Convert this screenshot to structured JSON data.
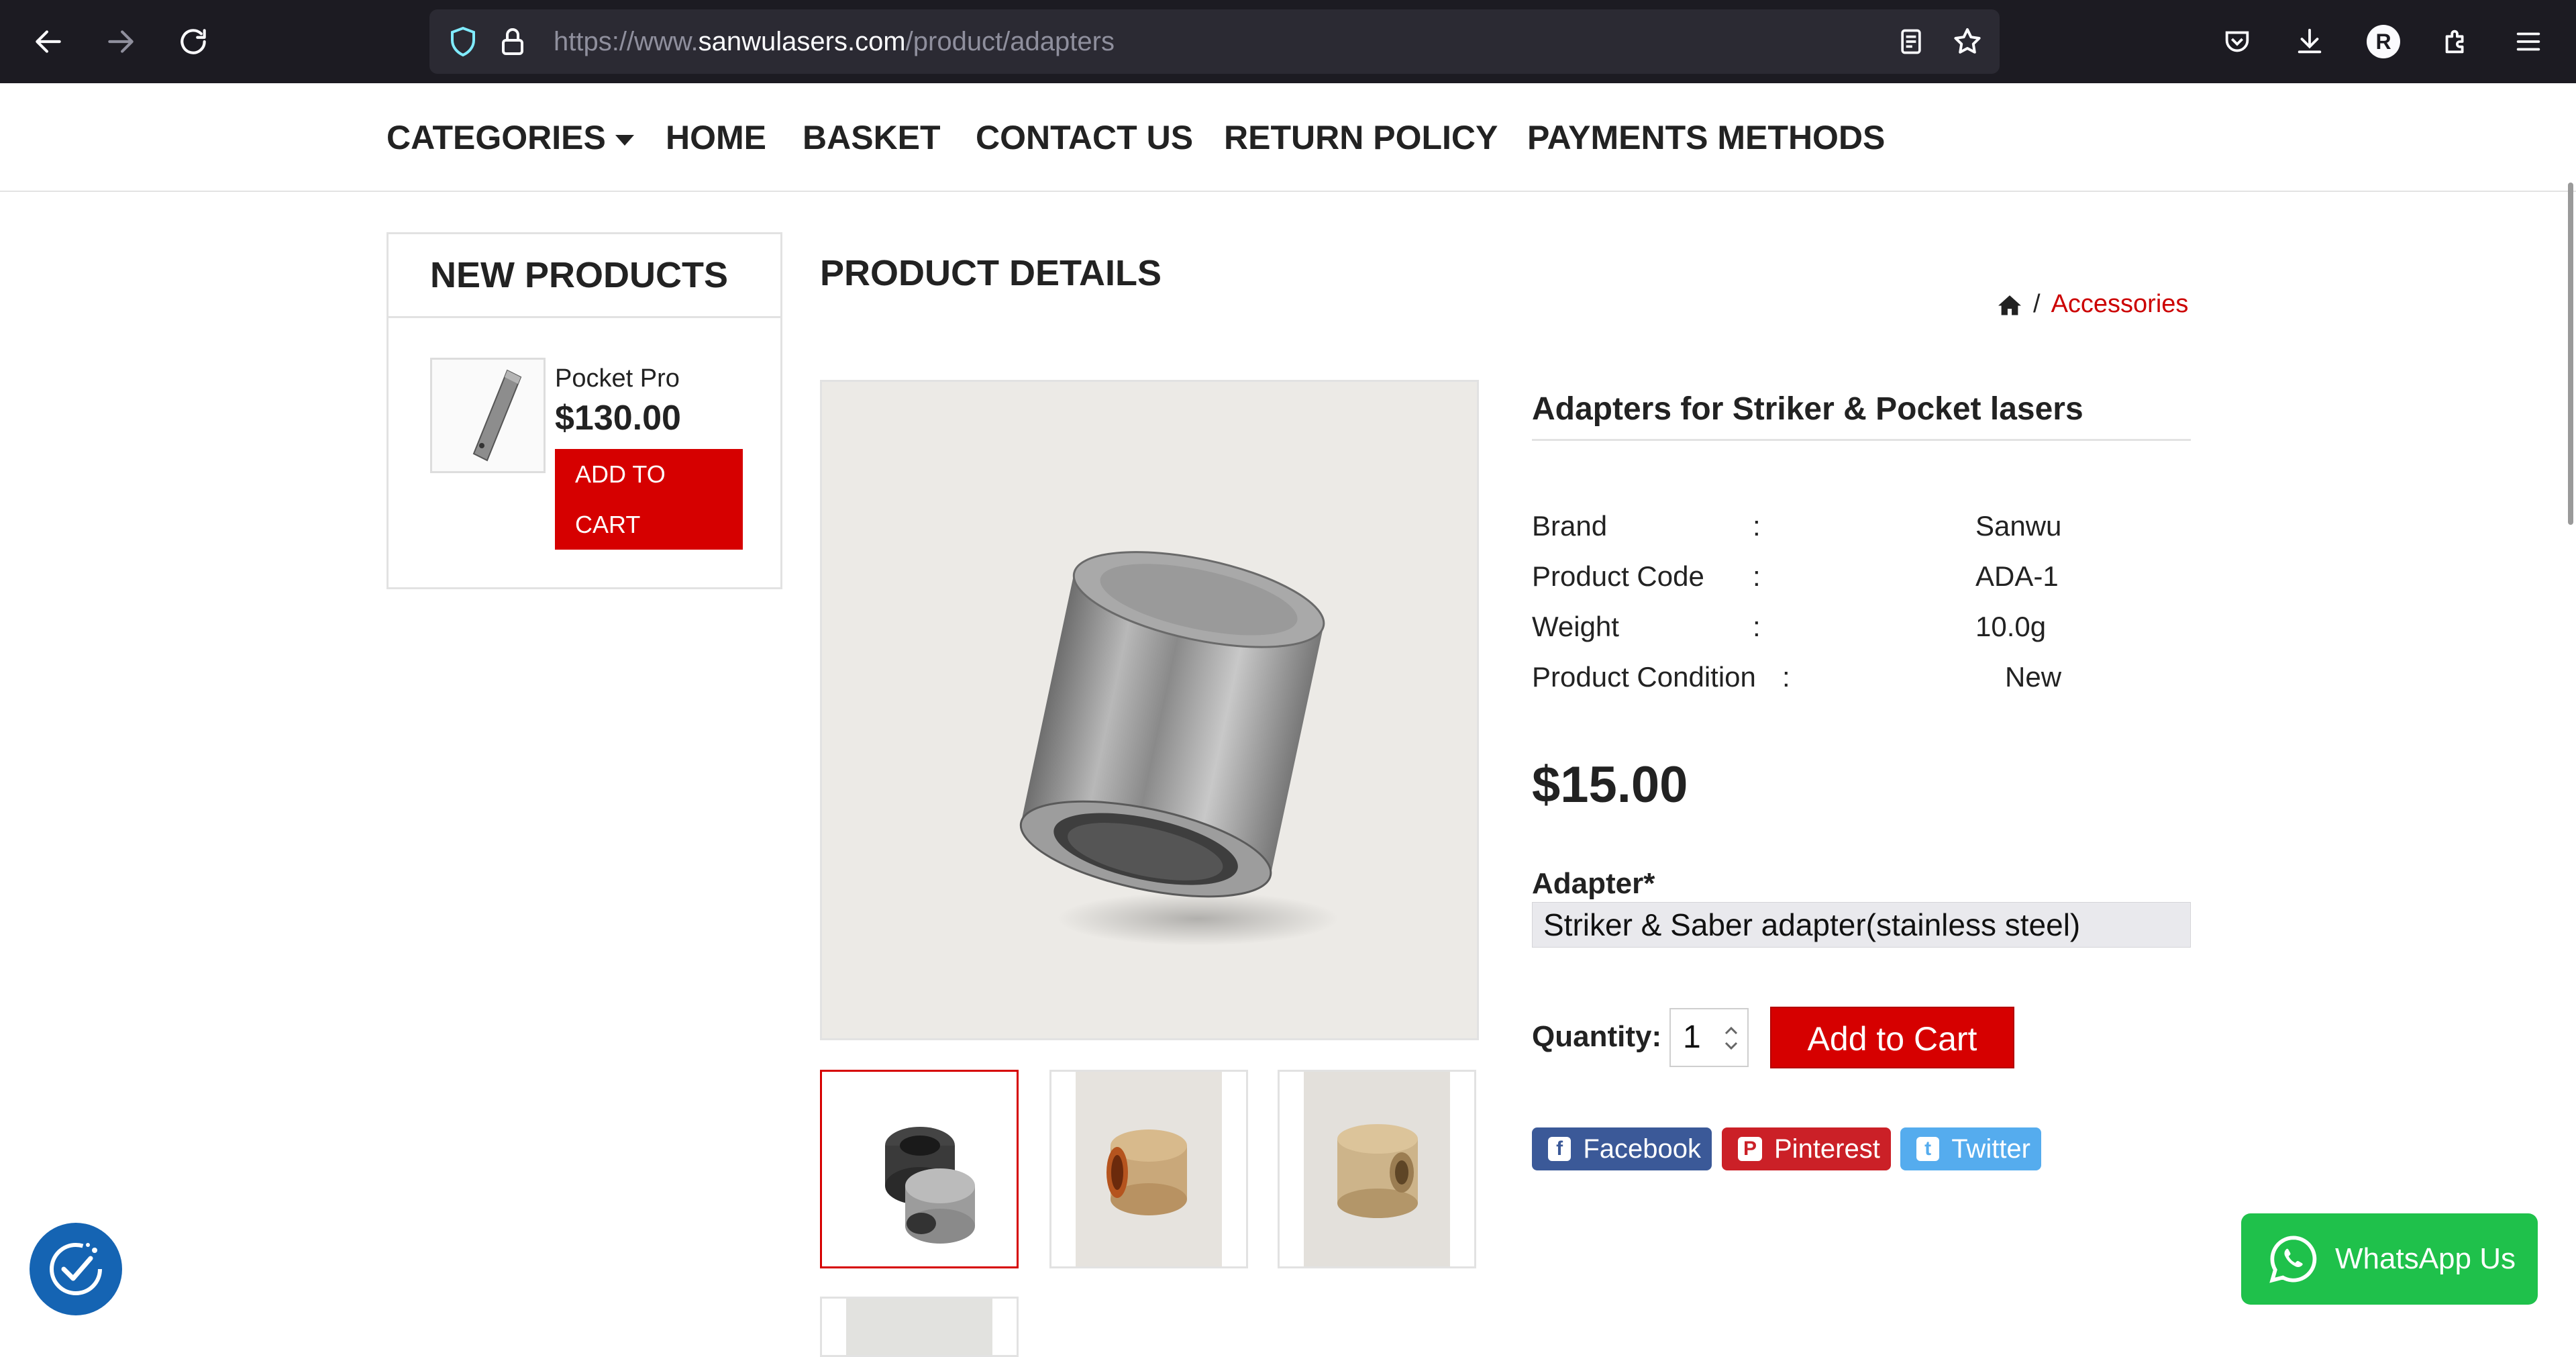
{
  "browser": {
    "url_prefix": "https://www.",
    "url_domain": "sanwulasers.com",
    "url_path": "/product/adapters",
    "profile_initial": "R"
  },
  "nav": {
    "categories": "CATEGORIES",
    "home": "HOME",
    "basket": "BASKET",
    "contact": "CONTACT US",
    "return_policy": "RETURN POLICY",
    "payments": "PAYMENTS METHODS"
  },
  "sidebar": {
    "title": "NEW PRODUCTS",
    "product": {
      "name": "Pocket Pro",
      "price": "$130.00",
      "add_line1": "ADD TO",
      "add_line2": "CART"
    }
  },
  "main": {
    "section_title": "PRODUCT DETAILS",
    "breadcrumb_sep": "/",
    "breadcrumb_link": "Accessories",
    "product_name": "Adapters for Striker & Pocket lasers",
    "specs": [
      {
        "label": "Brand",
        "colon": ":",
        "value": "Sanwu"
      },
      {
        "label": "Product Code",
        "colon": ":",
        "value": "ADA-1"
      },
      {
        "label": "Weight",
        "colon": ":",
        "value": "10.0g"
      },
      {
        "label": "Product Condition",
        "colon": ":",
        "value": "New"
      }
    ],
    "price": "$15.00",
    "option_label": "Adapter*",
    "option_selected": "Striker & Saber adapter(stainless steel)",
    "quantity_label": "Quantity:",
    "quantity_value": "1",
    "add_to_cart": "Add to Cart",
    "share": {
      "facebook": "Facebook",
      "pinterest": "Pinterest",
      "twitter": "Twitter"
    }
  },
  "whatsapp": "WhatsApp Us",
  "colors": {
    "accent_red": "#d60000",
    "link_red": "#cc0000",
    "facebook": "#3b5998",
    "pinterest": "#cb2027",
    "twitter": "#55acee",
    "whatsapp": "#1fc14b",
    "cookie": "#1564b3"
  }
}
